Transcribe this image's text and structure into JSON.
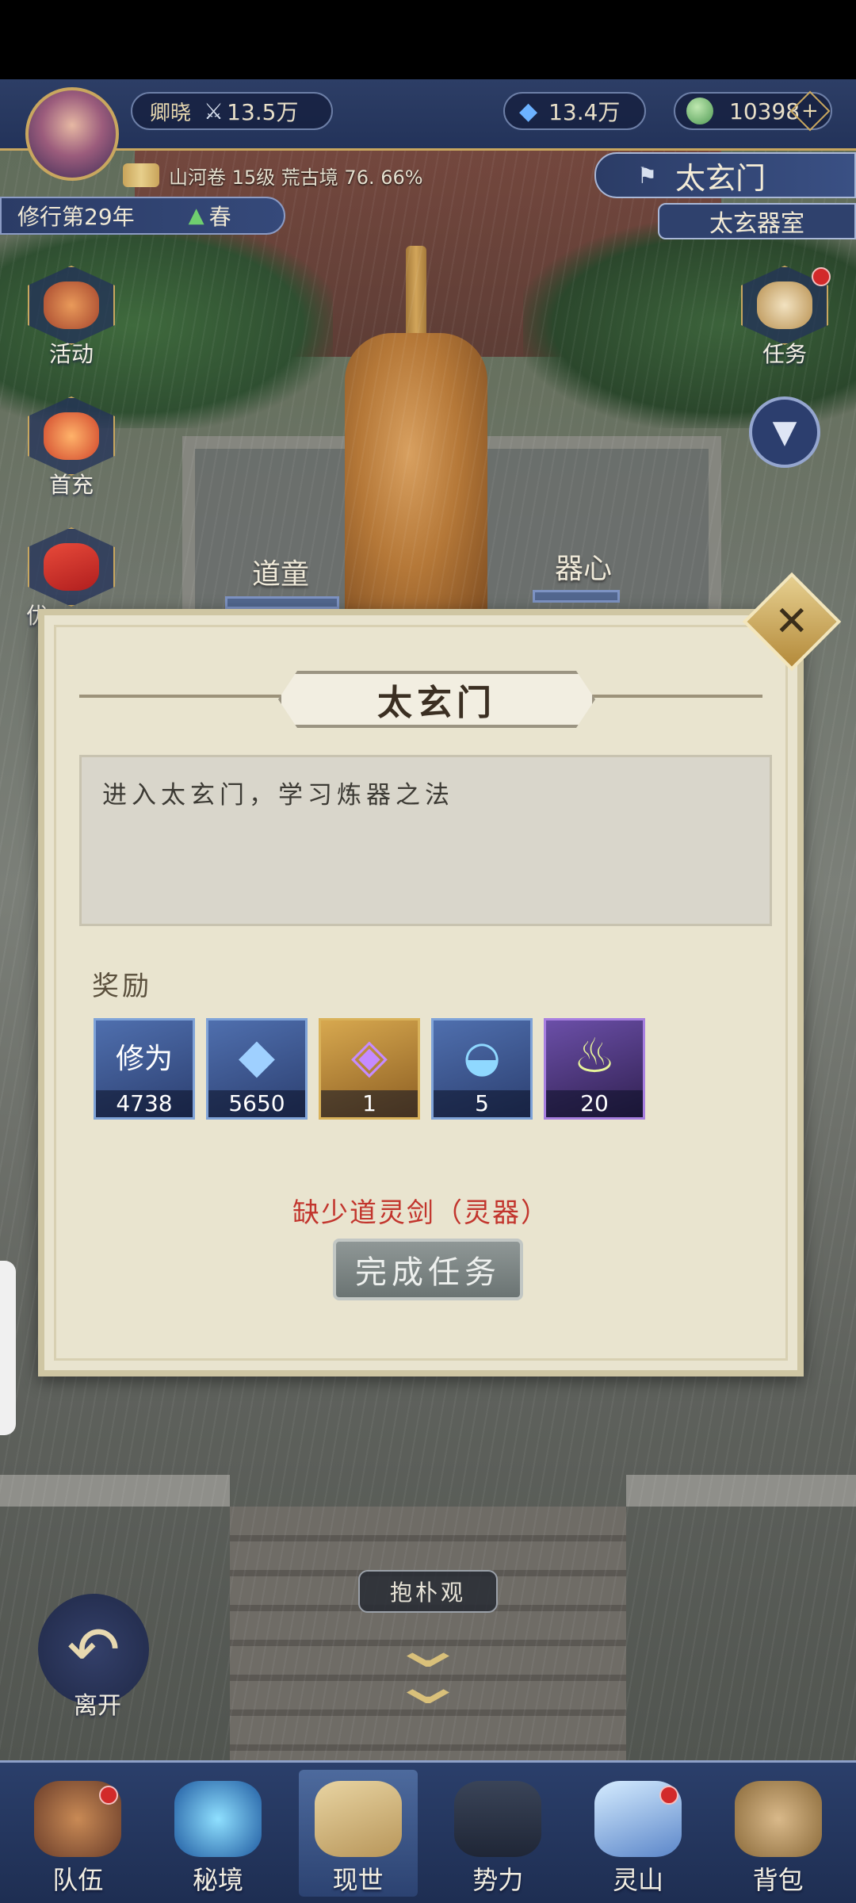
{
  "player": {
    "name": "卿晓",
    "power": "13.5万",
    "spirit_stones": "13.4万",
    "jade": "10398",
    "level_line": "山河卷 15级 荒古境 76. 66%",
    "year": "修行第29年",
    "season": "春"
  },
  "location": {
    "sect": "太玄门",
    "room": "太玄器室"
  },
  "side_buttons": {
    "activity": "活动",
    "first_recharge": "首充",
    "offer_partial": "优",
    "tasks": "任务"
  },
  "scene_labels": {
    "daotong": "道童",
    "qixin": "器心",
    "baopuguan": "抱朴观"
  },
  "dialog": {
    "title": "太玄门",
    "description": "进入太玄门，学习炼器之法",
    "reward_label": "奖励",
    "rewards": [
      {
        "icon": "xiuwei-icon",
        "art": "修为",
        "qty": "4738"
      },
      {
        "icon": "spirit-stone-icon",
        "art": "",
        "qty": "5650"
      },
      {
        "icon": "purple-gem-icon",
        "art": "",
        "qty": "1"
      },
      {
        "icon": "fan-icon",
        "art": "",
        "qty": "5"
      },
      {
        "icon": "spirit-flame-icon",
        "art": "",
        "qty": "20"
      }
    ],
    "lack_text": "缺少道灵剑（灵器）",
    "complete_button": "完成任务"
  },
  "leave_button": "离开",
  "bottom_nav": [
    {
      "label": "队伍",
      "icon": "team-icon",
      "badge": true,
      "active": false
    },
    {
      "label": "秘境",
      "icon": "secret-realm-icon",
      "badge": false,
      "active": false
    },
    {
      "label": "现世",
      "icon": "world-map-icon",
      "badge": false,
      "active": true
    },
    {
      "label": "势力",
      "icon": "faction-icon",
      "badge": false,
      "active": false
    },
    {
      "label": "灵山",
      "icon": "spirit-mountain-icon",
      "badge": true,
      "active": false
    },
    {
      "label": "背包",
      "icon": "bag-icon",
      "badge": false,
      "active": false
    }
  ],
  "colors": {
    "hud_blue": "#2d3e66",
    "gold_border": "#c9a75f",
    "dialog_bg": "#e9e4cf",
    "warning_red": "#c2352d"
  }
}
